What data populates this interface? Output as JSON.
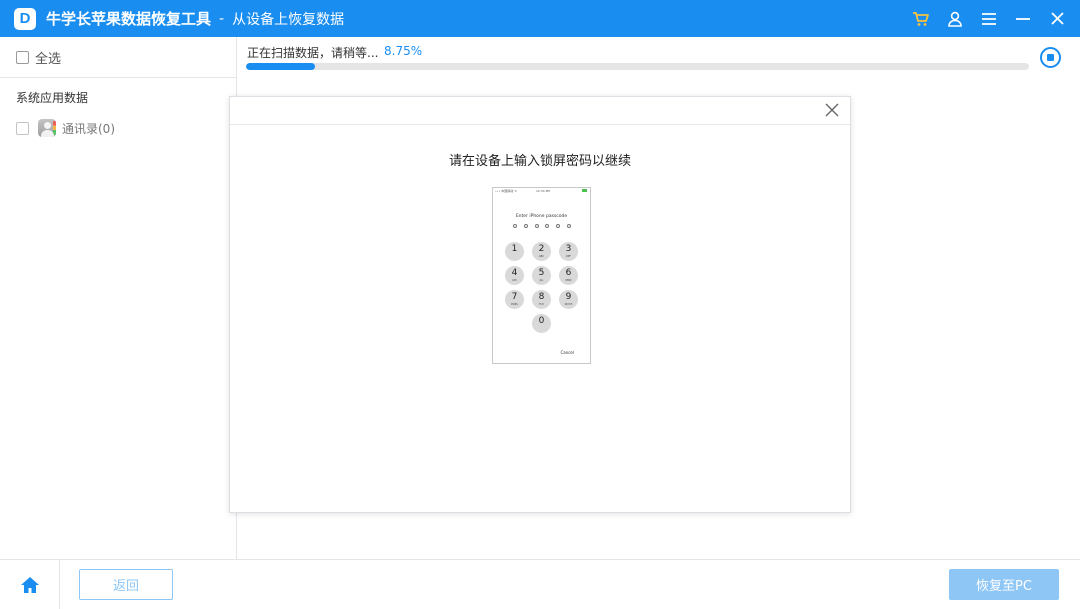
{
  "titlebar": {
    "logo_letter": "D",
    "app_title": "牛学长苹果数据恢复工具",
    "separator": "-",
    "subtitle": "从设备上恢复数据",
    "icons": [
      "cart-icon",
      "user-icon",
      "menu-icon",
      "minimize-icon",
      "close-icon"
    ]
  },
  "sidebar": {
    "select_all_label": "全选",
    "group_title": "系统应用数据",
    "items": [
      {
        "label": "通讯录(0)",
        "icon": "contacts-icon",
        "checked": false
      }
    ]
  },
  "scan": {
    "status_text": "正在扫描数据，请稍等...",
    "percent_text": "8.75%",
    "progress": 0.0875
  },
  "modal": {
    "message": "请在设备上输入锁屏密码以继续",
    "phone": {
      "carrier": "••• 中国移动 ᯤ",
      "time": "12:34 PM",
      "prompt": "Enter iPhone passcode",
      "keys": [
        {
          "num": "1",
          "letters": ""
        },
        {
          "num": "2",
          "letters": "ABC"
        },
        {
          "num": "3",
          "letters": "DEF"
        },
        {
          "num": "4",
          "letters": "GHI"
        },
        {
          "num": "5",
          "letters": "JKL"
        },
        {
          "num": "6",
          "letters": "MNO"
        },
        {
          "num": "7",
          "letters": "PQRS"
        },
        {
          "num": "8",
          "letters": "TUV"
        },
        {
          "num": "9",
          "letters": "WXYZ"
        },
        {
          "num": "0",
          "letters": ""
        }
      ],
      "cancel": "Cancel"
    }
  },
  "bottombar": {
    "back_label": "返回",
    "recover_label": "恢复至PC"
  },
  "colors": {
    "accent": "#1a8ef0",
    "disabled_accent": "#8ec6f5"
  }
}
